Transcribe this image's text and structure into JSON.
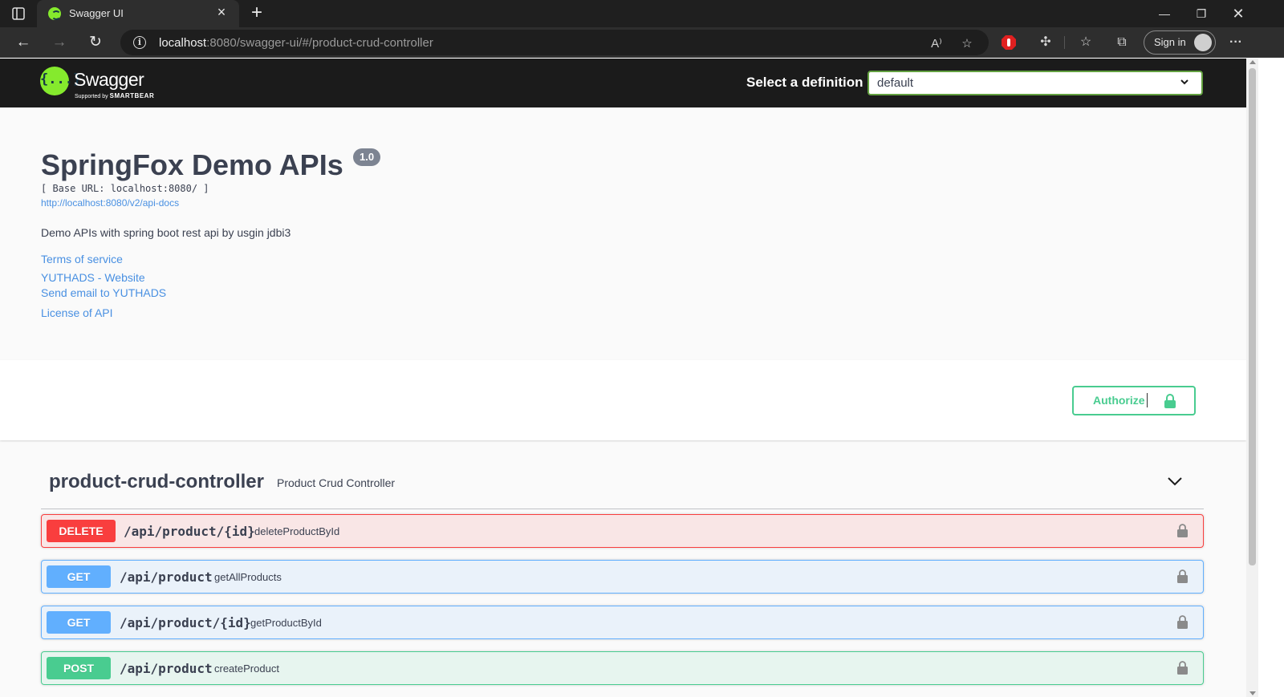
{
  "browser": {
    "tab_title": "Swagger UI",
    "url_host": "localhost",
    "url_rest": ":8080/swagger-ui/#/product-crud-controller",
    "signin_label": "Sign in"
  },
  "topbar": {
    "logo_text": "Swagger",
    "logo_sub_prefix": "Supported by",
    "logo_sub_brand": "SMARTBEAR",
    "logo_mark": "{...}",
    "definition_label": "Select a definition",
    "definition_value": "default"
  },
  "info": {
    "title": "SpringFox Demo APIs",
    "version": "1.0",
    "base_url": "[ Base URL: localhost:8080/ ]",
    "api_docs_link": "http://localhost:8080/v2/api-docs",
    "description": "Demo APIs with spring boot rest api by usgin jdbi3",
    "links": [
      "Terms of service",
      "YUTHADS - Website",
      "Send email to YUTHADS",
      "License of API"
    ]
  },
  "authorize": {
    "label": "Authorize"
  },
  "tag": {
    "name": "product-crud-controller",
    "description": "Product Crud Controller"
  },
  "operations": [
    {
      "method": "DELETE",
      "path": "/api/product/{id}",
      "summary": "deleteProductById"
    },
    {
      "method": "GET",
      "path": "/api/product",
      "summary": "getAllProducts"
    },
    {
      "method": "GET",
      "path": "/api/product/{id}",
      "summary": "getProductById"
    },
    {
      "method": "POST",
      "path": "/api/product",
      "summary": "createProduct"
    }
  ],
  "colors": {
    "delete": "#f93e3e",
    "get": "#61affe",
    "post": "#49cc90",
    "swagger_green": "#85ea2d",
    "link_blue": "#4990e2"
  },
  "icons": {
    "tab_favicon": "swagger-logo-icon",
    "security_lock": "lock-icon",
    "tag_toggle": "chevron-down-icon"
  }
}
